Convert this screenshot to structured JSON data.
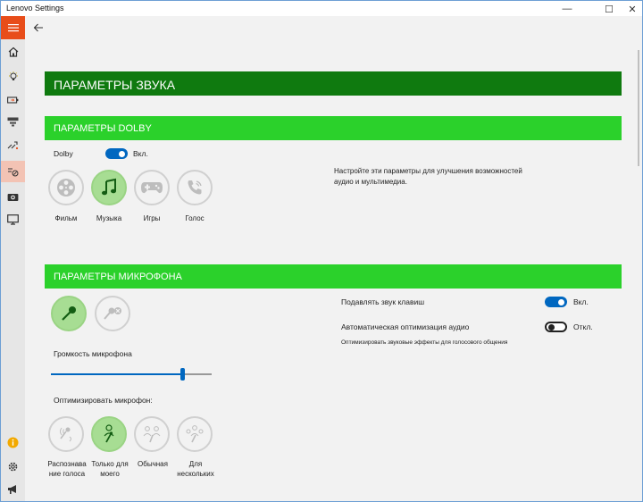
{
  "window": {
    "title": "Lenovo Settings",
    "minimize": "—",
    "maximize": "☐",
    "close": "✕"
  },
  "header": {
    "title": "ПАРАМЕТРЫ ЗВУКА"
  },
  "dolby": {
    "section_title": "ПАРАМЕТРЫ DOLBY",
    "label": "Dolby",
    "state": "Вкл.",
    "description": "Настройте эти параметры для улучшения возможностей аудио и мультимедиа.",
    "modes": [
      {
        "label": "Фильм",
        "selected": false
      },
      {
        "label": "Музыка",
        "selected": true
      },
      {
        "label": "Игры",
        "selected": false
      },
      {
        "label": "Голос",
        "selected": false
      }
    ]
  },
  "mic": {
    "section_title": "ПАРАМЕТРЫ МИКРОФОНА",
    "volume_label": "Громкость микрофона",
    "volume_level": 0.82,
    "optimize_label": "Оптимизировать микрофон:",
    "suppress_label": "Подавлять звук клавиш",
    "suppress_state": "Вкл.",
    "auto_opt_label": "Автоматическая оптимизация аудио",
    "auto_opt_state": "Откл.",
    "auto_opt_hint": "Оптимизировать звуковые эффекты для голосового общения",
    "modes": [
      {
        "label": "Распознава ние голоса",
        "selected": false
      },
      {
        "label": "Только для моего",
        "selected": true
      },
      {
        "label": "Обычная",
        "selected": false
      },
      {
        "label": "Для нескольких",
        "selected": false
      }
    ]
  },
  "colors": {
    "header": "#0f7a0f",
    "section": "#2bd12b",
    "accent": "#0067c0",
    "menu": "#e84d1a"
  }
}
